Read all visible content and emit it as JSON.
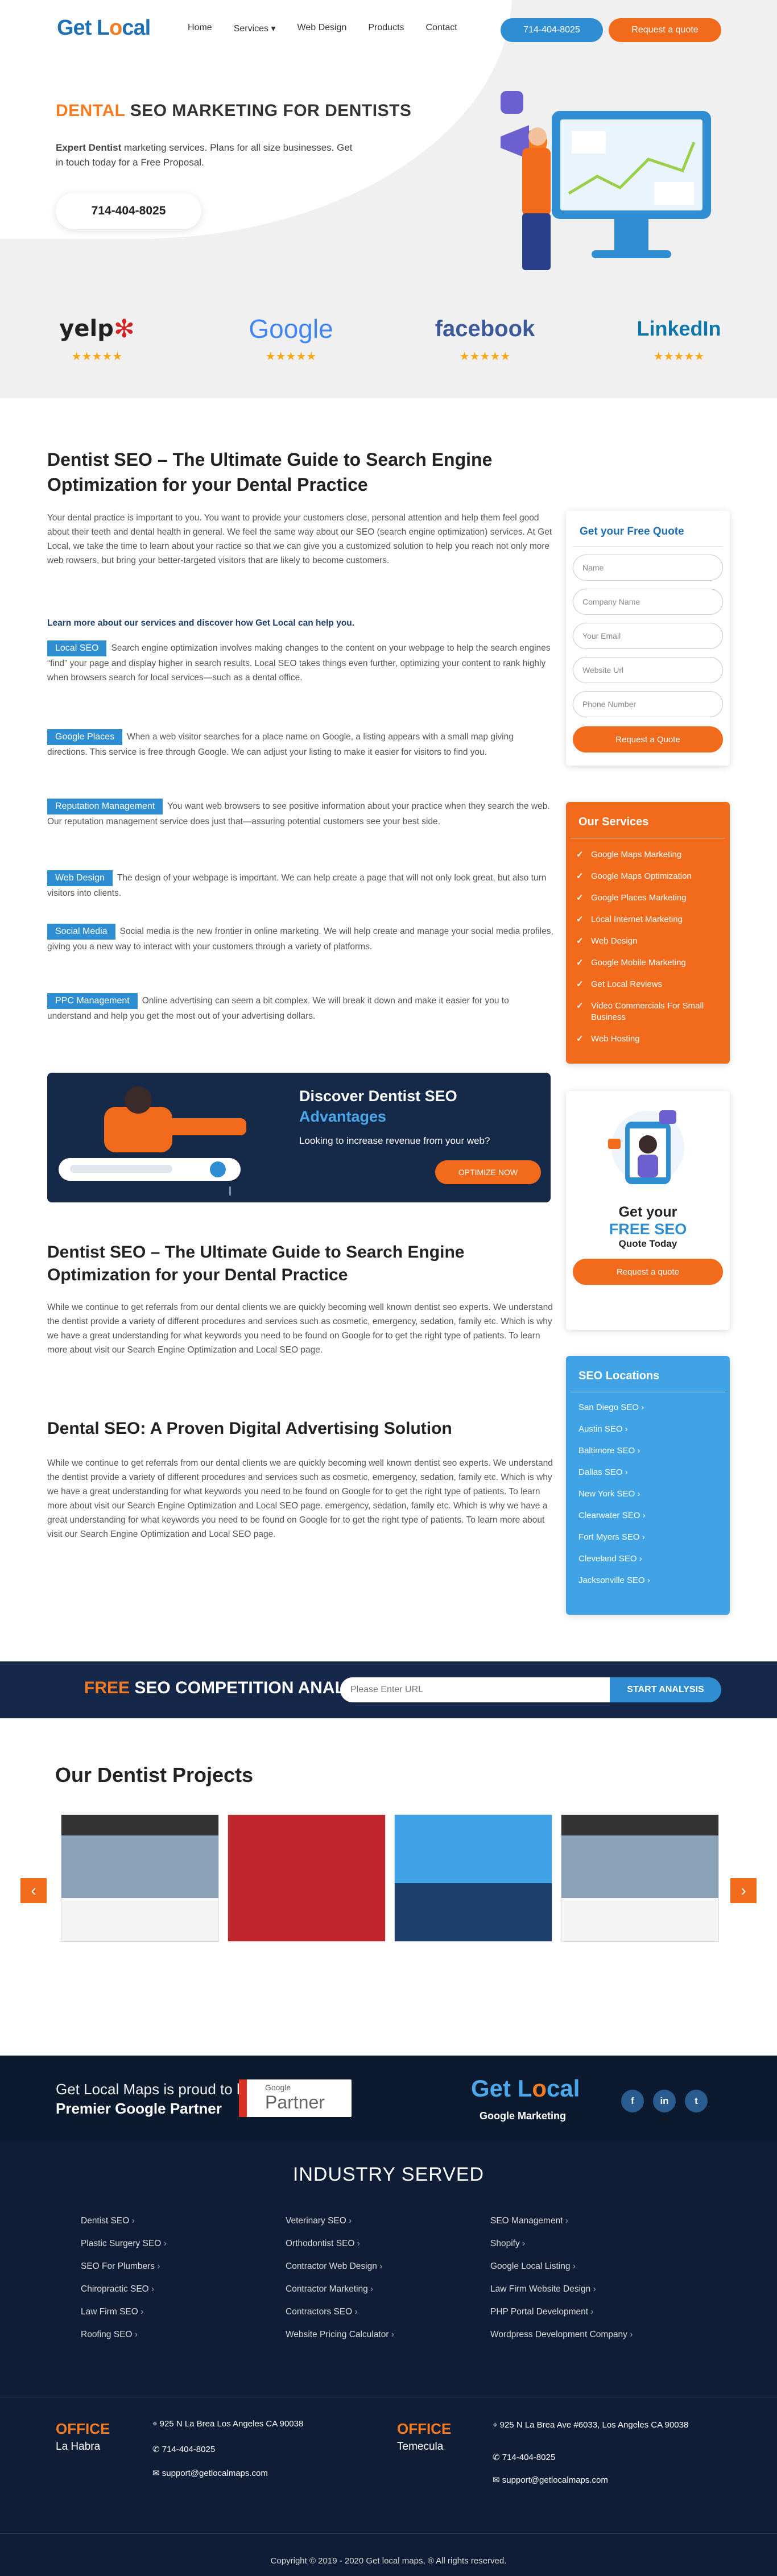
{
  "header": {
    "logo_a": "Get L",
    "logo_o": "o",
    "logo_b": "cal",
    "nav": [
      "Home",
      "Services ▾",
      "Web Design",
      "Products",
      "Contact"
    ],
    "phone": "714-404-8025",
    "quote": "Request a quote"
  },
  "hero": {
    "title_orange": "DENTAL",
    "title_rest": " SEO MARKETING FOR DENTISTS",
    "text_bold": "Expert Dentist",
    "text_rest": " marketing services. Plans for all size businesses. Get in touch today for a Free Proposal.",
    "phone": "714-404-8025",
    "brands": [
      "yelp",
      "Google",
      "facebook",
      "LinkedIn"
    ],
    "stars": "★★★★★"
  },
  "main": {
    "title": "Dentist SEO – The Ultimate Guide to Search Engine Optimization for your Dental Practice",
    "intro": "Your dental practice is important to you. You want to provide your customers close, personal attention and help them feel good about their teeth and dental health in general. We feel the same way about our SEO (search engine optimization) services. At Get Local, we take the time to learn about your ractice so that we can give you a customized solution to help you reach not only more web rowsers, but bring your better-targeted visitors that are likely to become customers.",
    "learn_more": "Learn more about our services and discover how Get Local can help you.",
    "services": [
      {
        "tag": "Local SEO",
        "text": "Search engine optimization involves making changes to the content on your webpage to help the search engines “find” your page and display higher in search results. Local SEO takes things even further, optimizing your content to rank highly when browsers search for local services—such as a dental office."
      },
      {
        "tag": "Google Places",
        "text": "When a web visitor searches for a place name on Google, a listing appears with a small map giving directions. This service is free through Google. We can adjust your listing to make it easier for visitors to find you."
      },
      {
        "tag": "Reputation Management",
        "text": "You want web browsers to see positive information about your practice when they search the web. Our reputation management service does just that—assuring potential customers see your best side."
      },
      {
        "tag": "Web Design",
        "text": "The design of your webpage is important. We can help create a page that will not only look great, but also turn visitors into clients."
      },
      {
        "tag": "Social Media",
        "text": "Social media is the new frontier in online marketing. We will help create and manage your social media profiles, giving you a new way to interact with your customers through a variety of platforms."
      },
      {
        "tag": "PPC Management",
        "text": "Online advertising can seem a bit complex. We will break it down and make it easier for you to understand and help you get the most out of your advertising dollars."
      }
    ],
    "banner": {
      "title1": "Discover Dentist SEO",
      "title2": "Advantages",
      "text": "Looking to increase revenue from your web?",
      "button": "OPTIMIZE NOW"
    },
    "h2a": "Dentist SEO – The Ultimate Guide to Search Engine Optimization for your Dental Practice",
    "p_a": "While we continue to get referrals from our dental clients we are quickly becoming well known dentist seo experts. We understand the dentist provide a variety of different procedures and services such as cosmetic, emergency, sedation, family etc. Which is why we have a great understanding for what keywords you need to be found on Google for to get the right type of patients. To learn more about visit our Search Engine Optimization and Local SEO page.",
    "h2b": "Dental SEO: A Proven Digital Advertising Solution",
    "p_b": "While we continue to get referrals from our dental clients we are quickly becoming well known dentist seo experts. We understand the dentist provide a variety of different procedures and services such as cosmetic, emergency, sedation, family etc. Which is why we have a great understanding for what keywords you need to be found on Google for to get the right type of patients. To learn more about visit our Search Engine Optimization and Local SEO page. emergency, sedation, family etc. Which is why we have a great understanding for what keywords you need to be found on Google for to get the right type of patients. To learn more about visit our Search Engine Optimization and Local SEO page."
  },
  "sidebar": {
    "quote_title": "Get your Free Quote",
    "fields": [
      "Name",
      "Company Name",
      "Your Email",
      "Website Url",
      "Phone Number"
    ],
    "quote_btn": "Request a Quote",
    "services_title": "Our Services",
    "services": [
      "Google Maps Marketing",
      "Google Maps Optimization",
      "Google Places Marketing",
      "Local Internet Marketing",
      "Web Design",
      "Google Mobile Marketing",
      "Get Local Reviews",
      "Video Commercials For Small Business",
      "Web Hosting"
    ],
    "cta_l1": "Get your",
    "cta_l2": "FREE SEO",
    "cta_l3": "Quote Today",
    "cta_btn": "Request a quote",
    "loc_title": "SEO Locations",
    "locations": [
      "San Diego SEO",
      "Austin SEO",
      "Baltimore SEO",
      "Dallas SEO",
      "New York SEO",
      "Clearwater SEO",
      "Fort Myers SEO",
      "Cleveland SEO",
      "Jacksonville SEO"
    ]
  },
  "strip": {
    "free": "FREE",
    "rest": " SEO COMPETITION ANALYSIS",
    "placeholder": "Please Enter URL",
    "button": "START ANALYSIS"
  },
  "projects": {
    "title": "Our Dentist Projects",
    "prev": "‹",
    "next": "›"
  },
  "footer": {
    "gp1": "Get Local Maps is proud to be a",
    "gp2": "Premier Google Partner",
    "partner_google": "Google",
    "partner": "Partner",
    "logo_a": "Get L",
    "logo_o": "o",
    "logo_b": "cal",
    "logo_sub": "Google Marketing",
    "social": [
      "f",
      "in",
      "t"
    ],
    "industry_title": "INDUSTRY SERVED",
    "industries": [
      "Dentist SEO",
      "Veterinary SEO",
      "SEO Management",
      "Plastic Surgery SEO",
      "Orthodontist SEO",
      "Shopify",
      "SEO For Plumbers",
      "Contractor Web Design",
      "Google Local Listing",
      "Chiropractic SEO",
      "Contractor Marketing",
      "Law Firm Website Design",
      "Law Firm SEO",
      "Contractors SEO",
      "PHP Portal Development",
      "Roofing SEO",
      "Website Pricing Calculator",
      "Wordpress Development Company"
    ],
    "office_label": "OFFICE",
    "office1": {
      "city": "La Habra",
      "addr": "925 N La Brea Los Angeles CA 90038",
      "phone": "714-404-8025",
      "email": "support@getlocalmaps.com"
    },
    "office2": {
      "city": "Temecula",
      "addr": "925 N La Brea Ave #6033, Los Angeles CA 90038",
      "phone": "714-404-8025",
      "email": "support@getlocalmaps.com"
    },
    "copyright": "Copyright © 2019 - 2020 Get local maps, ® All rights reserved."
  },
  "colors": {
    "accent": "#f26b1d",
    "blue": "#2f8ed1",
    "navy": "#0f1e36"
  }
}
